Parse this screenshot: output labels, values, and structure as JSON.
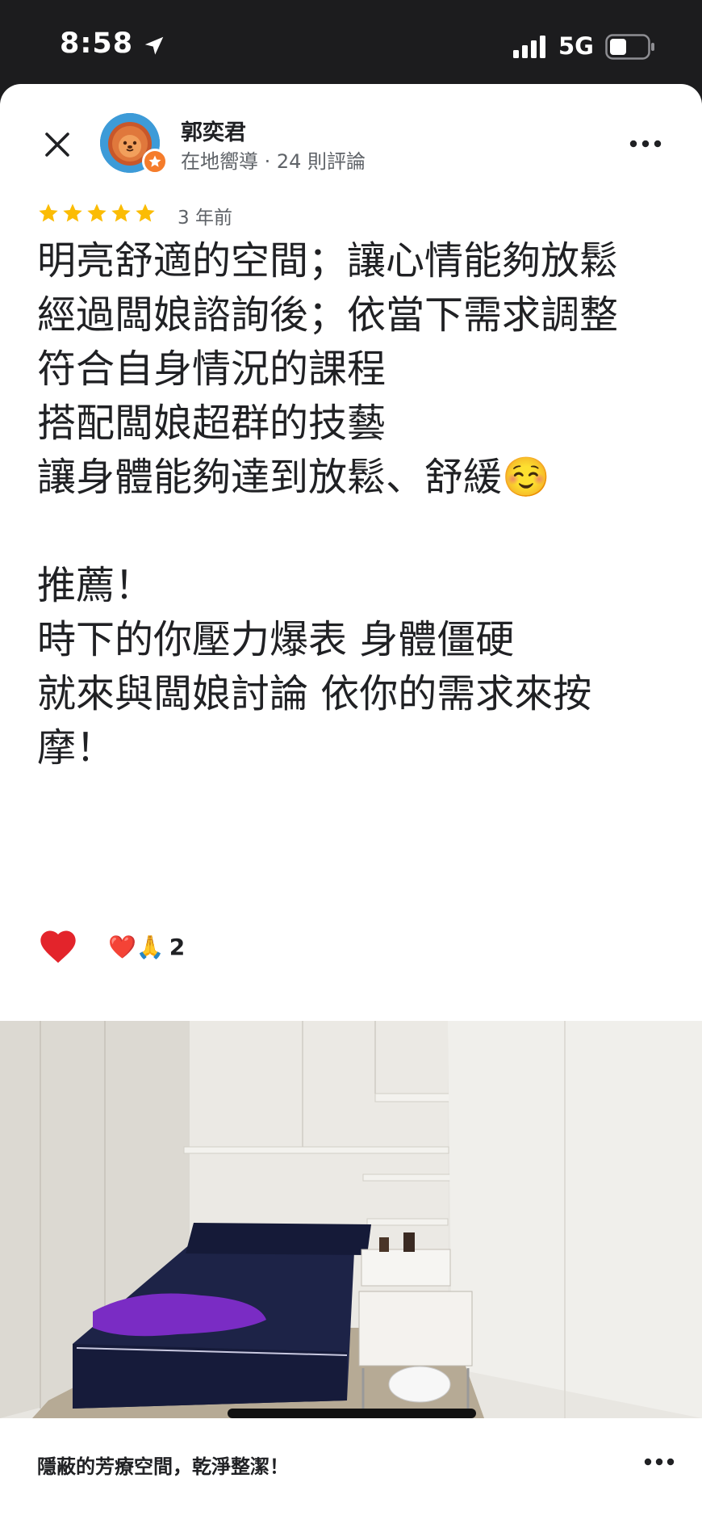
{
  "status_bar": {
    "time": "8:58",
    "network": "5G",
    "icons": [
      "location-arrow-icon",
      "signal-bars-icon",
      "battery-icon"
    ]
  },
  "review": {
    "author": "郭奕君",
    "author_meta": "在地嚮導 · 24 則評論",
    "rating": 5,
    "time_ago": "3 年前",
    "text": "明亮舒適的空間；讓心情能夠放鬆\n經過闆娘諮詢後；依當下需求調整\n符合自身情況的課程\n搭配闆娘超群的技藝\n讓身體能夠達到放鬆、舒緩☺️\n\n推薦！\n時下的你壓力爆表 身體僵硬\n就來與闆娘討論 依你的需求來按摩！",
    "reactions": {
      "emojis": "❤️🙏",
      "count": "2"
    }
  },
  "photo": {
    "caption": "隱蔽的芳療空間，乾淨整潔！"
  },
  "colors": {
    "star": "#fbbc04",
    "heart": "#e3242b",
    "text_primary": "#202124",
    "text_secondary": "#5f6368"
  }
}
